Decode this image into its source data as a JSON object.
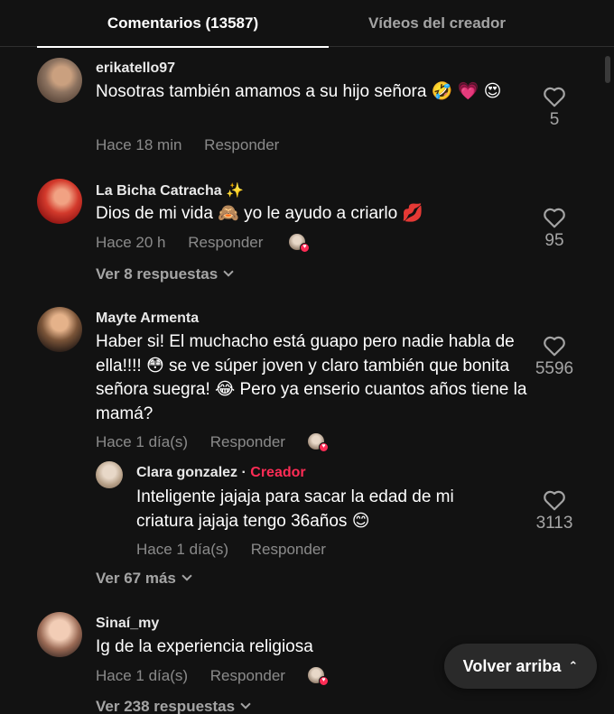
{
  "tabs": {
    "comments": "Comentarios (13587)",
    "creator_videos": "Vídeos del creador"
  },
  "comments": [
    {
      "username": "erikatello97",
      "text": "Nosotras también amamos a su hijo señora 🤣 💗 😍",
      "time": "Hace 18 min",
      "reply_label": "Responder",
      "likes": "5"
    },
    {
      "username": "La Bicha Catracha ✨",
      "text": "Dios de mi vida 🙈 yo le ayudo a criarlo 💋",
      "time": "Hace 20 h",
      "reply_label": "Responder",
      "likes": "95",
      "view_replies": "Ver 8 respuestas"
    },
    {
      "username": "Mayte Armenta",
      "text": "Haber si! El muchacho está guapo pero nadie habla de ella!!!! 😳 se ve súper joven y claro también que bonita señora suegra! 😂 Pero ya enserio cuantos años tiene la mamá?",
      "time": "Hace 1 día(s)",
      "reply_label": "Responder",
      "likes": "5596",
      "reply": {
        "username": "Clara gonzalez",
        "separator": "·",
        "creator_tag": "Creador",
        "text": "Inteligente jajaja para sacar la edad de mi criatura jajaja tengo 36años 😊",
        "time": "Hace 1 día(s)",
        "reply_label": "Responder",
        "likes": "3113"
      },
      "view_more": "Ver 67 más"
    },
    {
      "username": "Sinaí_my",
      "text": "Ig de la experiencia religiosa",
      "time": "Hace 1 día(s)",
      "reply_label": "Responder",
      "view_replies": "Ver 238 respuestas"
    }
  ],
  "back_to_top": "Volver arriba",
  "icons": {
    "like": "heart-outline-icon",
    "creator_liked": "creator-liked-heart-icon",
    "chevron": "chevron-down-icon",
    "back_top": "double-chevron-up-icon"
  },
  "colors": {
    "background": "#121212",
    "accent": "#fe2c55"
  }
}
